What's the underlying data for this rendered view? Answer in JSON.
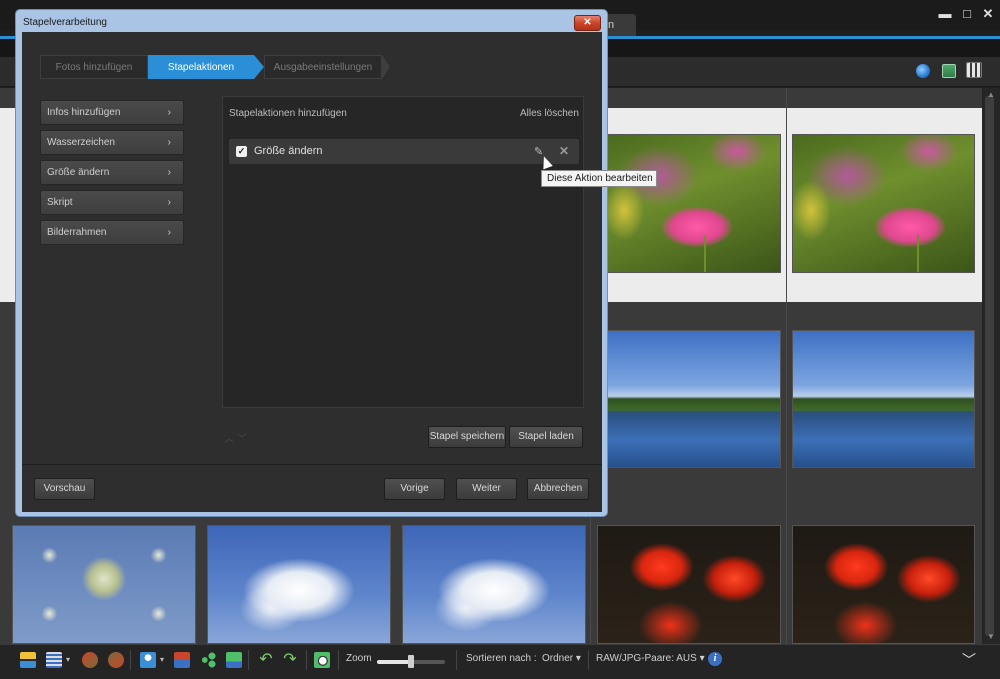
{
  "app": {
    "tab_label": "n",
    "window_controls": {
      "minimize": "▬",
      "maximize": "□",
      "close": "✕"
    }
  },
  "dialog": {
    "title": "Stapelverarbeitung",
    "close_label": "✕",
    "steps": [
      "Fotos hinzufügen",
      "Stapelaktionen",
      "Ausgabeeinstellungen"
    ],
    "active_step": 1,
    "side_actions": [
      {
        "label": "Infos hinzufügen"
      },
      {
        "label": "Wasserzeichen"
      },
      {
        "label": "Größe ändern"
      },
      {
        "label": "Skript"
      },
      {
        "label": "Bilderrahmen"
      }
    ],
    "chevron": "›",
    "panel": {
      "title": "Stapelaktionen hinzufügen",
      "clear_label": "Alles löschen",
      "actions": [
        {
          "label": "Größe ändern",
          "checked": true
        }
      ],
      "tooltip": "Diese Aktion bearbeiten",
      "updown": "︿ ﹀"
    },
    "buttons": {
      "save_batch": "Stapel speichern",
      "load_batch": "Stapel laden",
      "preview": "Vorschau",
      "previous": "Vorige",
      "next": "Weiter",
      "cancel": "Abbrechen"
    }
  },
  "bottombar": {
    "zoom_label": "Zoom",
    "zoom_level": 0.5,
    "sort_label": "Sortieren nach :",
    "sort_value": "Ordner",
    "raw_label": "RAW/JPG-Paare: AUS",
    "info": "i",
    "caret": "▾",
    "collapse": "﹀"
  },
  "colors": {
    "accent": "#2a8fd6",
    "dialog_frame": "#a9c4e4",
    "close_red": "#c9452b"
  },
  "icons": [
    "minimize-icon",
    "maximize-icon",
    "close-icon",
    "globe-icon",
    "map-icon",
    "grid-view-icon",
    "checkbox-icon",
    "pencil-icon",
    "delete-icon",
    "info-icon",
    "chevron-down-icon"
  ]
}
